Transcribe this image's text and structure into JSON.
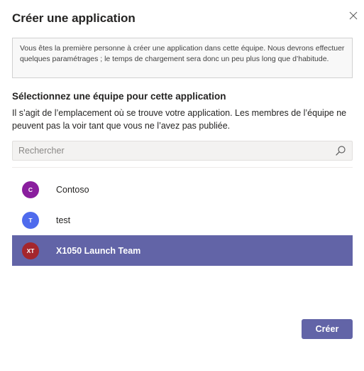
{
  "dialog": {
    "title": "Créer une application",
    "close_icon": "close-icon"
  },
  "notice": {
    "text": "Vous êtes la première personne à créer une application dans cette équipe. Nous devrons effectuer quelques paramétrages ; le temps de chargement sera donc un peu plus long que d’habitude."
  },
  "section": {
    "title": "Sélectionnez une équipe pour cette application",
    "description": "Il s’agit de l’emplacement où se trouve votre application. Les membres de l’équipe ne peuvent pas la voir tant que vous ne l’avez pas publiée."
  },
  "search": {
    "placeholder": "Rechercher",
    "value": "",
    "icon": "search-icon"
  },
  "teams": [
    {
      "initials": "C",
      "name": "Contoso",
      "avatar_color": "#8a1e9e",
      "selected": false
    },
    {
      "initials": "T",
      "name": "test",
      "avatar_color": "#4f6bed",
      "selected": false
    },
    {
      "initials": "XT",
      "name": "X1050 Launch Team",
      "avatar_color": "#a4262c",
      "selected": true
    }
  ],
  "footer": {
    "create_label": "Créer"
  },
  "colors": {
    "accent": "#6264a7"
  }
}
